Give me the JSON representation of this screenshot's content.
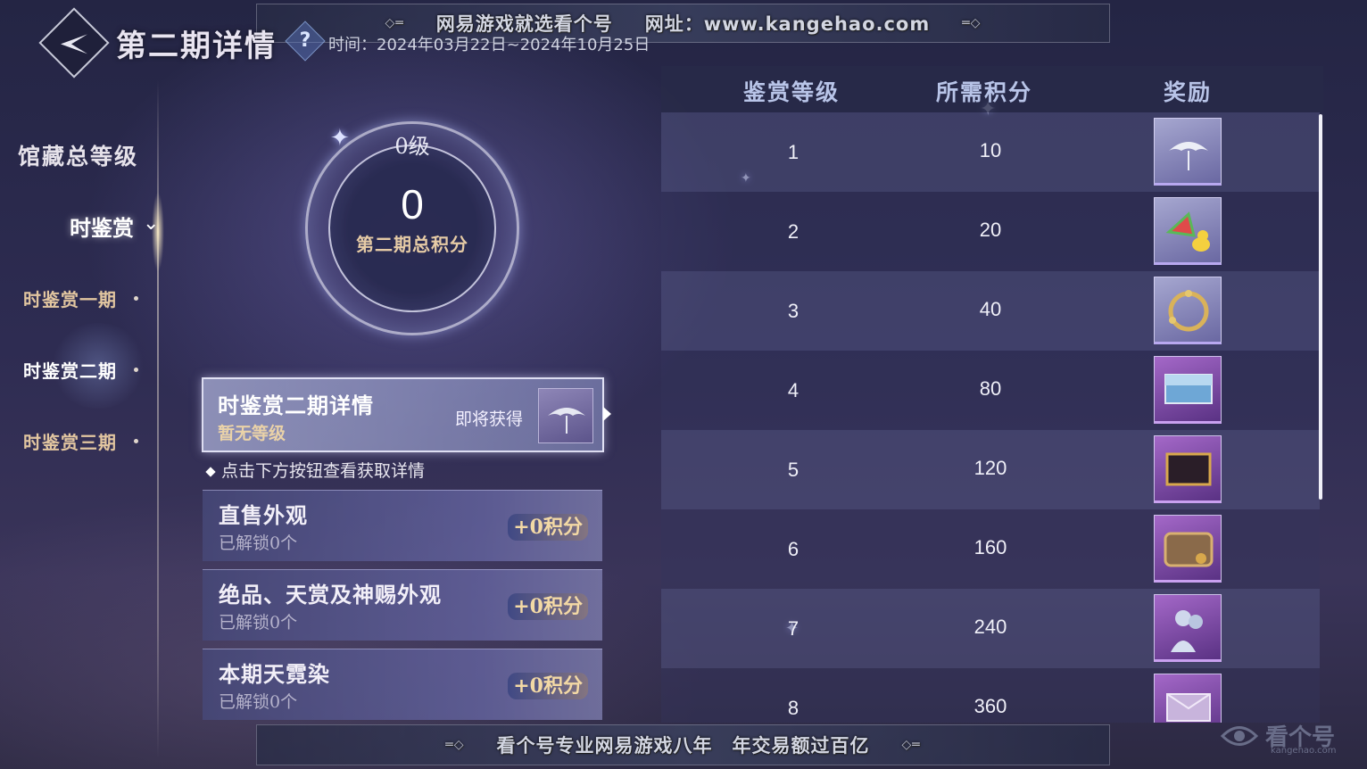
{
  "watermark": {
    "top_text": "网易游戏就选看个号",
    "top_url": "网址：www.kangehao.com",
    "bottom_text": "看个号专业网易游戏八年　年交易额过百亿",
    "corner_logo": "看个号",
    "corner_logo_sub": "kangehao.com"
  },
  "header": {
    "title": "第二期详情",
    "help_symbol": "?",
    "date_range": "时间：2024年03月22日~2024年10月25日"
  },
  "sidebar": {
    "main_item": "馆藏总等级",
    "active_item": "时鉴赏",
    "sub_items": [
      {
        "label": "时鉴赏一期",
        "selected": false
      },
      {
        "label": "时鉴赏二期",
        "selected": true
      },
      {
        "label": "时鉴赏三期",
        "selected": false
      }
    ]
  },
  "summary": {
    "level": "0级",
    "score": "0",
    "score_label": "第二期总积分"
  },
  "detail_card": {
    "title": "时鉴赏二期详情",
    "subtitle": "暂无等级",
    "upcoming_label": "即将获得"
  },
  "hint": "点击下方按钮查看获取详情",
  "sources": [
    {
      "name": "直售外观",
      "count": "已解锁0个",
      "points": "+0积分"
    },
    {
      "name": "绝品、天赏及神赐外观",
      "count": "已解锁0个",
      "points": "+0积分"
    },
    {
      "name": "本期天霓染",
      "count": "已解锁0个",
      "points": "+0积分"
    }
  ],
  "table": {
    "headers": [
      "鉴赏等级",
      "所需积分",
      "奖励"
    ],
    "rows": [
      {
        "level": "1",
        "points": "10",
        "reward_icon": "umbrella-icon",
        "frame": "bluish"
      },
      {
        "level": "2",
        "points": "20",
        "reward_icon": "watermelon-duck-icon",
        "frame": "bluish"
      },
      {
        "level": "3",
        "points": "40",
        "reward_icon": "golden-ring-icon",
        "frame": "bluish"
      },
      {
        "level": "4",
        "points": "80",
        "reward_icon": "blue-frame-icon",
        "frame": "purple"
      },
      {
        "level": "5",
        "points": "120",
        "reward_icon": "gold-frame-icon",
        "frame": "purple"
      },
      {
        "level": "6",
        "points": "160",
        "reward_icon": "ornate-frame-icon",
        "frame": "purple"
      },
      {
        "level": "7",
        "points": "240",
        "reward_icon": "portrait-icon",
        "frame": "purple"
      },
      {
        "level": "8",
        "points": "360",
        "reward_icon": "envelope-frame-icon",
        "frame": "purple"
      }
    ]
  }
}
